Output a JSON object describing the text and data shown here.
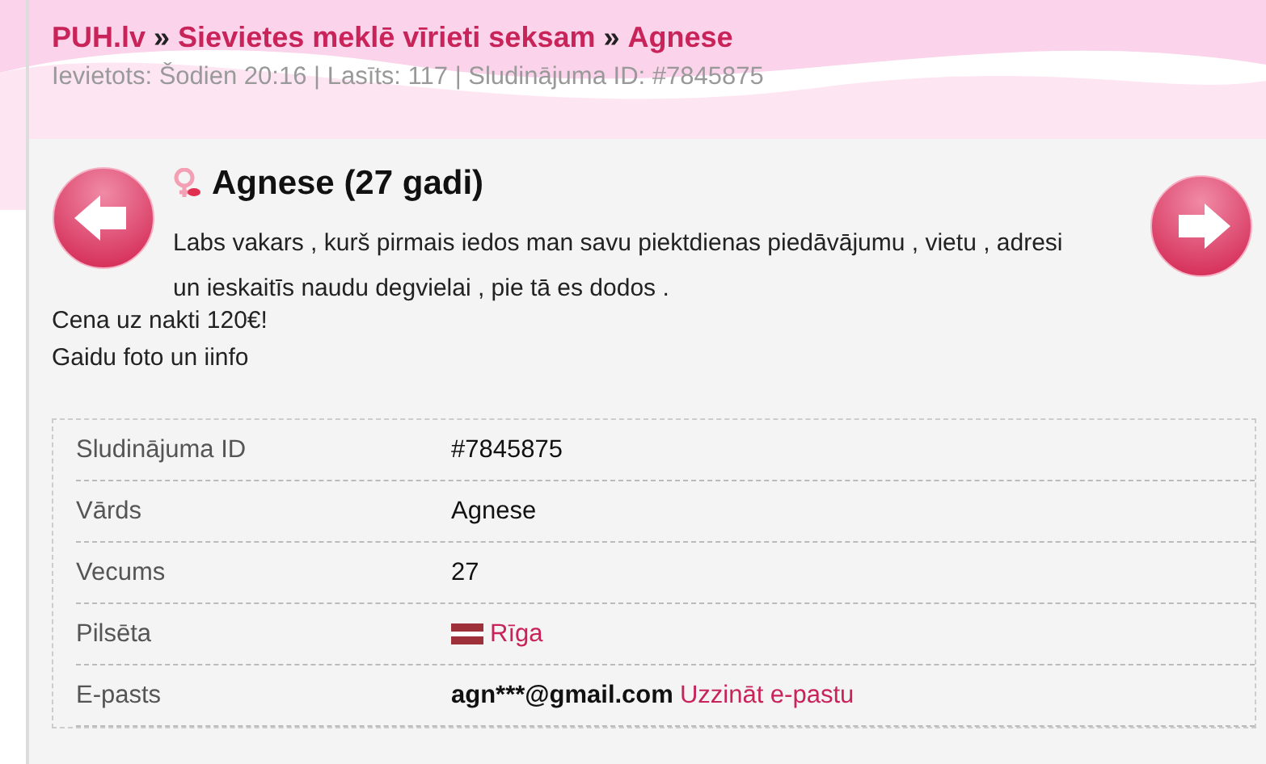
{
  "breadcrumb": [
    {
      "label": "PUH.lv"
    },
    {
      "label": "Sievietes meklē vīrieti seksam"
    },
    {
      "label": "Agnese"
    }
  ],
  "breadcrumb_separator": "»",
  "meta": "Ievietots: Šodien 20:16 | Lasīts: 117 | Sludinājuma ID: #7845875",
  "title": "Agnese (27 gadi)",
  "description": [
    "Labs vakars , kurš pirmais iedos man savu piektdienas piedāvājumu , vietu , adresi un ieskaitīs naudu degvielai , pie tā es dodos ."
  ],
  "extra_lines": [
    "Cena uz nakti 120€!",
    "Gaidu foto un iinfo"
  ],
  "details": [
    {
      "kind": "text",
      "label": "Sludinājuma ID",
      "value": "#7845875"
    },
    {
      "kind": "text",
      "label": "Vārds",
      "value": "Agnese"
    },
    {
      "kind": "text",
      "label": "Vecums",
      "value": "27"
    },
    {
      "kind": "city",
      "label": "Pilsēta",
      "value": "Rīga"
    },
    {
      "kind": "email",
      "label": "E-pasts",
      "value": "agn***@gmail.com",
      "link": "Uzzināt e-pastu"
    }
  ]
}
